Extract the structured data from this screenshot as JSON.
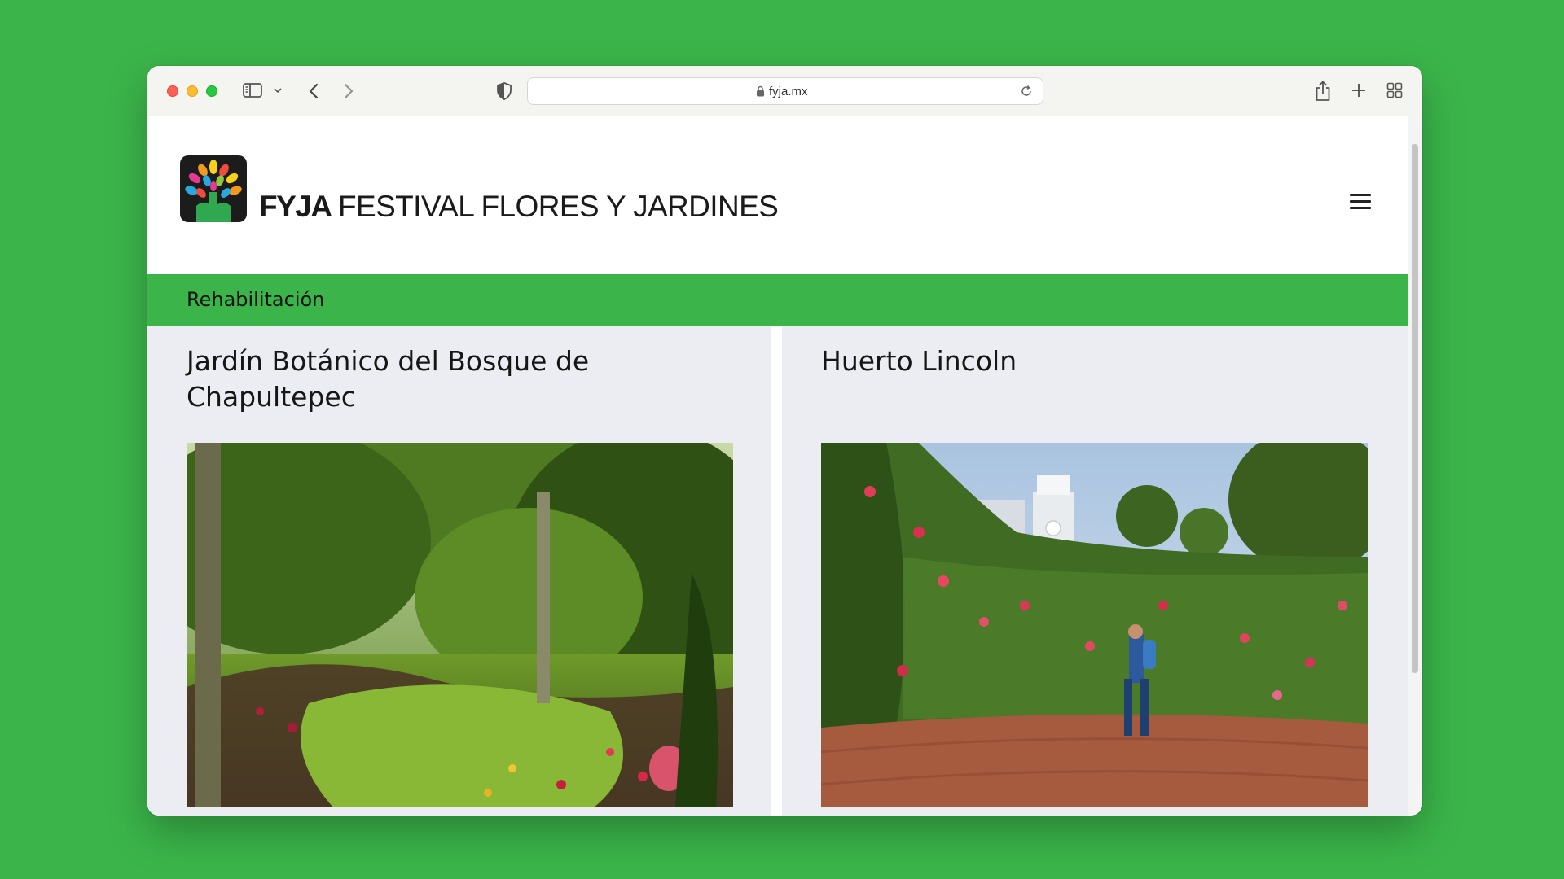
{
  "browser": {
    "url": "fyja.mx"
  },
  "site": {
    "brand": "FYJA",
    "tagline": "FESTIVAL FLORES Y JARDINES"
  },
  "category": {
    "label": "Rehabilitación"
  },
  "cards": [
    {
      "title": "Jardín Botánico del Bosque de Chapultepec"
    },
    {
      "title": "Huerto Lincoln"
    }
  ],
  "colors": {
    "brand_green": "#3bb54a",
    "card_bg": "#ebedf2",
    "text": "#161616"
  }
}
